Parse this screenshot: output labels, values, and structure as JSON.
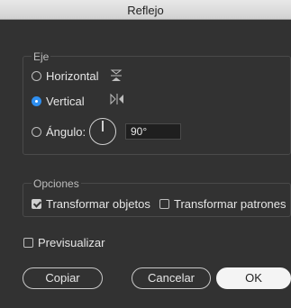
{
  "window": {
    "title": "Reflejo"
  },
  "axis": {
    "label": "Eje",
    "options": [
      {
        "id": "horizontal",
        "label": "Horizontal",
        "selected": false,
        "icon": "reflect-horizontal-icon"
      },
      {
        "id": "vertical",
        "label": "Vertical",
        "selected": true,
        "icon": "reflect-vertical-icon"
      },
      {
        "id": "angle",
        "label": "Ángulo:",
        "selected": false,
        "icon": "angle-dial-icon"
      }
    ],
    "angle_value": "90°"
  },
  "options": {
    "label": "Opciones",
    "transform_objects": {
      "label": "Transformar objetos",
      "checked": true
    },
    "transform_patterns": {
      "label": "Transformar patrones",
      "checked": false
    }
  },
  "preview": {
    "label": "Previsualizar",
    "checked": false
  },
  "buttons": {
    "copy": "Copiar",
    "cancel": "Cancelar",
    "ok": "OK"
  },
  "colors": {
    "background": "#323232",
    "accent": "#2f8ff0",
    "primary_button": "#f4f4f4"
  }
}
